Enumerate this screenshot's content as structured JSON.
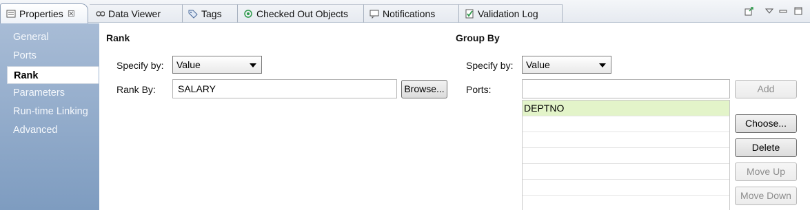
{
  "tabs": [
    {
      "label": "Properties",
      "icon": "properties-icon",
      "active": true,
      "close": "☒"
    },
    {
      "label": "Data Viewer",
      "icon": "data-viewer-icon"
    },
    {
      "label": "Tags",
      "icon": "tag-icon"
    },
    {
      "label": "Checked Out Objects",
      "icon": "checked-out-icon"
    },
    {
      "label": "Notifications",
      "icon": "notifications-icon"
    },
    {
      "label": "Validation Log",
      "icon": "validation-log-icon"
    }
  ],
  "sidebar": {
    "items": [
      "General",
      "Ports",
      "Rank",
      "Parameters",
      "Run-time Linking",
      "Advanced"
    ],
    "active": "Rank"
  },
  "rank": {
    "title": "Rank",
    "specify_label": "Specify by:",
    "specify_value": "Value",
    "rank_by_label": "Rank By:",
    "rank_by_value": "SALARY",
    "browse_label": "Browse..."
  },
  "group_by": {
    "title": "Group By",
    "specify_label": "Specify by:",
    "specify_value": "Value",
    "ports_label": "Ports:",
    "ports_value": "",
    "add_label": "Add",
    "choose_label": "Choose...",
    "delete_label": "Delete",
    "move_up_label": "Move Up",
    "move_down_label": "Move Down",
    "ports_list": [
      "DEPTNO",
      "",
      "",
      "",
      "",
      "",
      ""
    ]
  },
  "colors": {
    "sidebar_top": "#a8bcd6",
    "sidebar_bottom": "#7e9cc0",
    "selected_row": "#e3f4c9"
  }
}
